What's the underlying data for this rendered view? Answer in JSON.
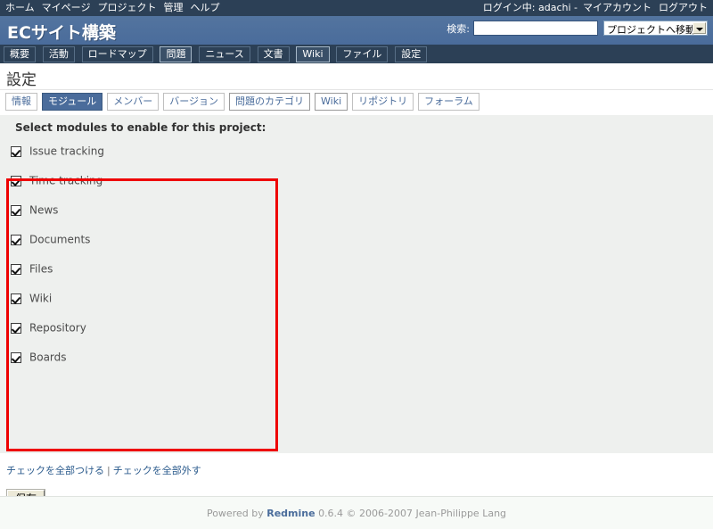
{
  "top_menu": {
    "items": [
      {
        "label": "ホーム",
        "name": "home"
      },
      {
        "label": "マイページ",
        "name": "my-page"
      },
      {
        "label": "プロジェクト",
        "name": "projects"
      },
      {
        "label": "管理",
        "name": "administration"
      },
      {
        "label": "ヘルプ",
        "name": "help"
      }
    ],
    "logged_as": "ログイン中: adachi -",
    "account_label": "マイアカウント",
    "logout_label": "ログアウト"
  },
  "header": {
    "project_title": "ECサイト構築",
    "search_label": "検索:",
    "search_value": "",
    "search_placeholder": "",
    "project_jump_label": "プロジェクトへ移動..."
  },
  "main_menu": {
    "items": [
      {
        "label": "概要",
        "name": "overview",
        "selected": false
      },
      {
        "label": "活動",
        "name": "activity",
        "selected": false
      },
      {
        "label": "ロードマップ",
        "name": "roadmap",
        "selected": false
      },
      {
        "label": "問題",
        "name": "issues",
        "selected": true
      },
      {
        "label": "ニュース",
        "name": "news",
        "selected": false
      },
      {
        "label": "文書",
        "name": "documents",
        "selected": false
      },
      {
        "label": "Wiki",
        "name": "wiki",
        "selected": true
      },
      {
        "label": "ファイル",
        "name": "files",
        "selected": false
      },
      {
        "label": "設定",
        "name": "settings",
        "selected": false
      }
    ]
  },
  "page": {
    "title": "設定"
  },
  "sub_tabs": {
    "items": [
      {
        "label": "情報",
        "name": "info",
        "selected": false,
        "raised": false
      },
      {
        "label": "モジュール",
        "name": "modules",
        "selected": true,
        "raised": false
      },
      {
        "label": "メンバー",
        "name": "members",
        "selected": false,
        "raised": false
      },
      {
        "label": "バージョン",
        "name": "versions",
        "selected": false,
        "raised": false
      },
      {
        "label": "問題のカテゴリ",
        "name": "issue-categories",
        "selected": false,
        "raised": true
      },
      {
        "label": "Wiki",
        "name": "wiki",
        "selected": false,
        "raised": true
      },
      {
        "label": "リポジトリ",
        "name": "repository",
        "selected": false,
        "raised": false
      },
      {
        "label": "フォーラム",
        "name": "boards",
        "selected": false,
        "raised": false
      }
    ]
  },
  "modules": {
    "legend": "Select modules to enable for this project:",
    "items": [
      {
        "label": "Issue tracking",
        "name": "issue-tracking",
        "checked": true
      },
      {
        "label": "Time tracking",
        "name": "time-tracking",
        "checked": true
      },
      {
        "label": "News",
        "name": "news",
        "checked": true
      },
      {
        "label": "Documents",
        "name": "documents",
        "checked": true
      },
      {
        "label": "Files",
        "name": "files",
        "checked": true
      },
      {
        "label": "Wiki",
        "name": "wiki",
        "checked": true
      },
      {
        "label": "Repository",
        "name": "repository",
        "checked": true
      },
      {
        "label": "Boards",
        "name": "boards",
        "checked": true
      }
    ],
    "check_all_label": "チェックを全部つける",
    "separator": "|",
    "uncheck_all_label": "チェックを全部外す",
    "save_label": "保存"
  },
  "annotation": {
    "color": "#ee0000"
  },
  "footer": {
    "powered_by": "Powered by",
    "app_name": "Redmine",
    "version_copyright": "0.6.4 © 2006-2007 Jean-Philippe Lang"
  }
}
